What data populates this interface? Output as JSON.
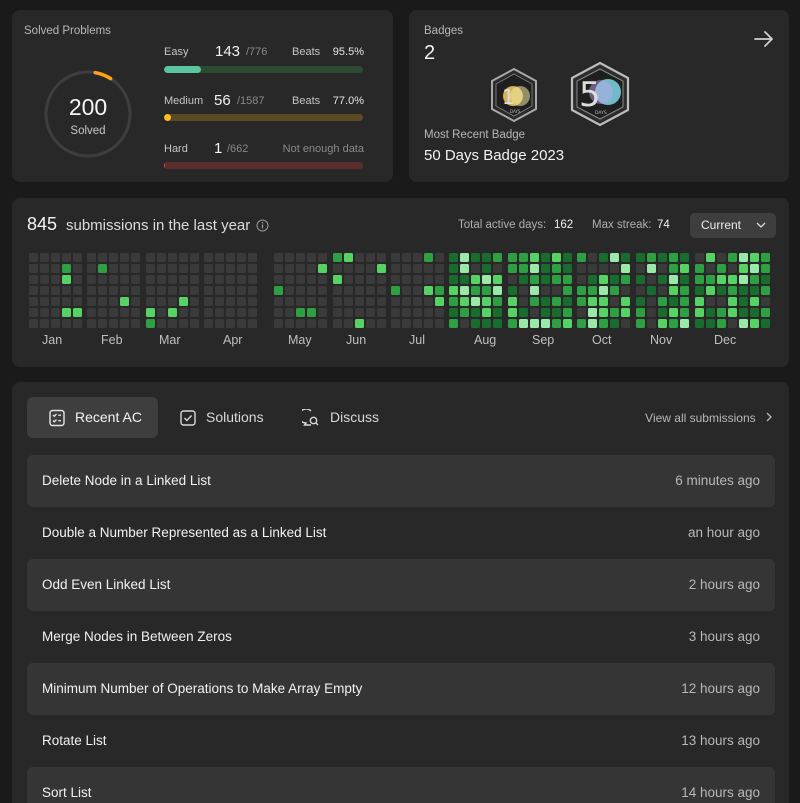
{
  "solved": {
    "title": "Solved Problems",
    "total": "200",
    "total_label": "Solved",
    "progress": 0.063,
    "easy": {
      "name": "Easy",
      "solved": "143",
      "total": "/776",
      "beats_label": "Beats",
      "beats": "95.5%",
      "fraction": 0.184,
      "color": "#2cbb5d"
    },
    "medium": {
      "name": "Medium",
      "solved": "56",
      "total": "/1587",
      "beats_label": "Beats",
      "beats": "77.0%",
      "fraction": 0.035,
      "color": "#ffc01e"
    },
    "hard": {
      "name": "Hard",
      "solved": "1",
      "total": "/662",
      "note": "Not enough data",
      "fraction": 0.0015,
      "color": "#ef4743"
    }
  },
  "badges": {
    "title": "Badges",
    "count": "2",
    "items": [
      {
        "name": "100-days-badge-icon",
        "digits": "100"
      },
      {
        "name": "50-days-badge-icon",
        "digits": "50"
      }
    ],
    "recent_label": "Most Recent Badge",
    "recent_name": "50 Days Badge 2023"
  },
  "submissions": {
    "count": "845",
    "text": "submissions in the last year",
    "active_days_label": "Total active days:",
    "active_days": "162",
    "streak_label": "Max streak:",
    "streak": "74",
    "year_option": "Current",
    "months": [
      "Jan",
      "Feb",
      "Mar",
      "Apr",
      "May",
      "Jun",
      "Jul",
      "Aug",
      "Sep",
      "Oct",
      "Nov",
      "Dec"
    ],
    "colors": {
      "empty": "#3a3a3a",
      "l1": "#196c2e",
      "l2": "#2ea043",
      "l3": "#56d364",
      "l4": "#9be9a8"
    }
  },
  "recent": {
    "tabs": [
      {
        "label": "Recent AC",
        "icon": "checklist-icon"
      },
      {
        "label": "Solutions",
        "icon": "check-square-icon"
      },
      {
        "label": "Discuss",
        "icon": "discuss-icon"
      }
    ],
    "view_all": "View all submissions",
    "items": [
      {
        "title": "Delete Node in a Linked List",
        "time": "6 minutes ago"
      },
      {
        "title": "Double a Number Represented as a Linked List",
        "time": "an hour ago"
      },
      {
        "title": "Odd Even Linked List",
        "time": "2 hours ago"
      },
      {
        "title": "Merge Nodes in Between Zeros",
        "time": "3 hours ago"
      },
      {
        "title": "Minimum Number of Operations to Make Array Empty",
        "time": "12 hours ago"
      },
      {
        "title": "Rotate List",
        "time": "13 hours ago"
      },
      {
        "title": "Sort List",
        "time": "14 hours ago"
      }
    ]
  }
}
